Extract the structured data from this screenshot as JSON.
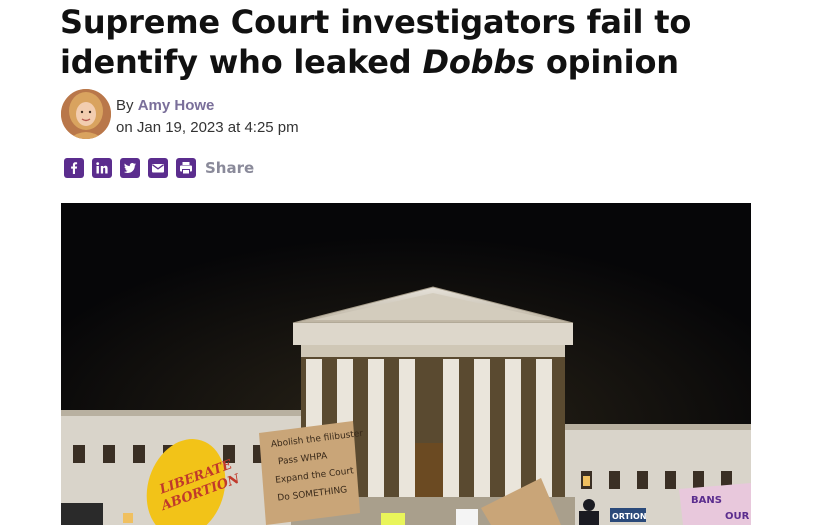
{
  "article": {
    "headline_before": "Supreme Court investigators fail to identify who leaked ",
    "headline_emphasis": "Dobbs",
    "headline_after": " opinion",
    "byline_prefix": "By",
    "author": "Amy Howe",
    "date_line": "on Jan 19, 2023 at 4:25 pm"
  },
  "share": {
    "label": "Share",
    "icons": [
      "facebook-icon",
      "linkedin-icon",
      "twitter-icon",
      "email-icon",
      "print-icon"
    ]
  },
  "hero_image": {
    "sign_liberate": [
      "LIBERATE",
      "ABORTION"
    ],
    "sign_cardboard": [
      "Abolish the filibuster",
      "Pass WHPA",
      "Expand the Court",
      "Do SOMETHING"
    ],
    "sign_right": [
      "BANS",
      "OUR"
    ],
    "sign_small": "ORTION"
  },
  "colors": {
    "accent": "#5b2d8e",
    "author_link": "#7a6f9a",
    "share_label": "#8a8a9a"
  }
}
